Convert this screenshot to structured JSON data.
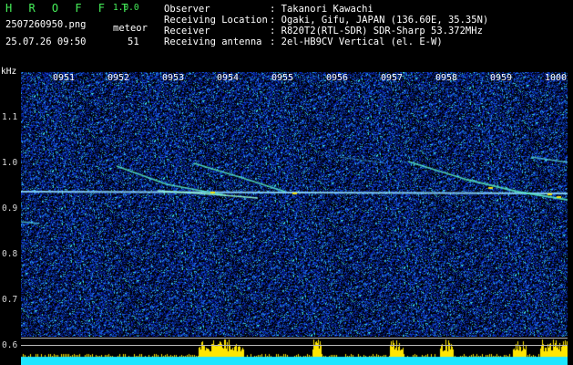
{
  "header": {
    "app_name": "H R O F F T",
    "version": "1.0.0",
    "filename": "2507260950.png",
    "datetime": "25.07.26 09:50",
    "meteor_label": "meteor",
    "meteor_count": "51",
    "info": [
      {
        "label": "Observer",
        "value": ": Takanori Kawachi"
      },
      {
        "label": "Receiving Location",
        "value": ": Ogaki, Gifu, JAPAN (136.60E, 35.35N)"
      },
      {
        "label": "Receiver",
        "value": ": R820T2(RTL-SDR) SDR-Sharp 53.372MHz"
      },
      {
        "label": "Receiving antenna",
        "value": ": 2el-HB9CV Vertical (el. E-W)"
      }
    ]
  },
  "spectrogram": {
    "y_unit": "kHz",
    "y_ticks": [
      "1.1",
      "1.0",
      "0.9",
      "0.8",
      "0.7",
      "0.6"
    ],
    "x_ticks": [
      "0951",
      "0952",
      "0953",
      "0954",
      "0955",
      "0956",
      "0957",
      "0958",
      "0959",
      "1000"
    ],
    "colors": {
      "background": "#000000",
      "noise": "#1432c8",
      "signal": "#ffe600",
      "baseline": "#1ee6ff"
    }
  }
}
